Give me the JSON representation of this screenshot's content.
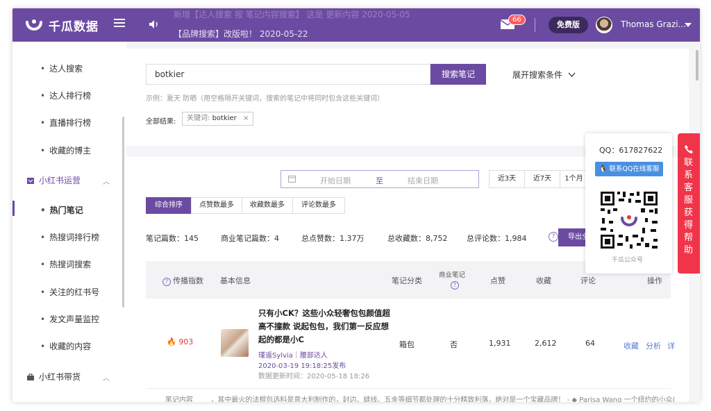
{
  "app": {
    "name": "千瓜数据",
    "brand_color": "#6b4ba1"
  },
  "header": {
    "notice_line1": "新增【达人搜索 按 笔记内容搜索】 这是 更新内容 2020-05-05",
    "notice_line2": "【品牌搜索】改版啦！ 2020-05-22",
    "mail_badge": "66",
    "plan_label": "免费版",
    "username": "Thomas Grazi..."
  },
  "sidebar": {
    "items_top": [
      "达人搜索",
      "达人排行榜",
      "直播排行榜",
      "收藏的博主"
    ],
    "group1": "小红书运营",
    "items_ops": [
      "热门笔记",
      "热搜词排行榜",
      "热搜词搜索",
      "关注的红书号",
      "发文声量监控",
      "收藏的内容"
    ],
    "group2": "小红书带货"
  },
  "search": {
    "value": "botkier",
    "button": "搜索笔记",
    "expand": "展开搜索条件",
    "hint": "示例：夏天 防晒（用空格隔开关键词，搜索的笔记中将同时包含这些关键词）",
    "results_label": "全部结果:",
    "tag_prefix": "关键词: ",
    "tag_value": "botkier",
    "tag_close": "×"
  },
  "filters": {
    "start_placeholder": "开始日期",
    "to": "至",
    "end_placeholder": "结束日期",
    "quick": [
      "近3天",
      "近7天",
      "1个月"
    ],
    "sort_tabs": [
      "综合排序",
      "点赞数最多",
      "收藏数最多",
      "评论数最多"
    ]
  },
  "stats": {
    "notes": "笔记篇数：145",
    "commercial": "商业笔记篇数：4",
    "likes": "总点赞数：1.37万",
    "collects": "总收藏数：8,752",
    "comments": "总评论数：1,984",
    "help": "?",
    "export": "导出全"
  },
  "table": {
    "headers": {
      "spread": "传播指数",
      "info": "基本信息",
      "category": "笔记分类",
      "commercial": "商业笔记",
      "likes": "点赞",
      "collects": "收藏",
      "comments": "评论",
      "actions": "操作"
    },
    "row": {
      "spread": "903",
      "title": "只有小CK？这些小众轻奢包包颜值超高不撞款 说起包包，我们第一反应想起的都是小C",
      "author": "瑾遥Sylvia｜腰部达人",
      "published": "2020-03-19 19:18:25发布",
      "updated": "数据更新时间：2020-05-18 18:26",
      "category": "箱包",
      "commercial": "否",
      "likes": "1,931",
      "collects": "2,612",
      "comments": "64",
      "action_collect": "收藏",
      "action_analyze": "分析",
      "action_more": "详"
    },
    "content_label": "笔记内容",
    "content_preview": "，其中最火的法棍包选料是意大利制作的，封边、缝线、五金等细节都处理的十分精致利落，绝对是一个宝藏品牌！ - ◆ Parisa Wang 一个纽约的小众("
  },
  "qq_popover": {
    "qq": "QQ：617827622",
    "button": "联系QQ在线客服",
    "caption": "千瓜公众号"
  },
  "help_tab": {
    "text": "联系客服获得帮助"
  }
}
